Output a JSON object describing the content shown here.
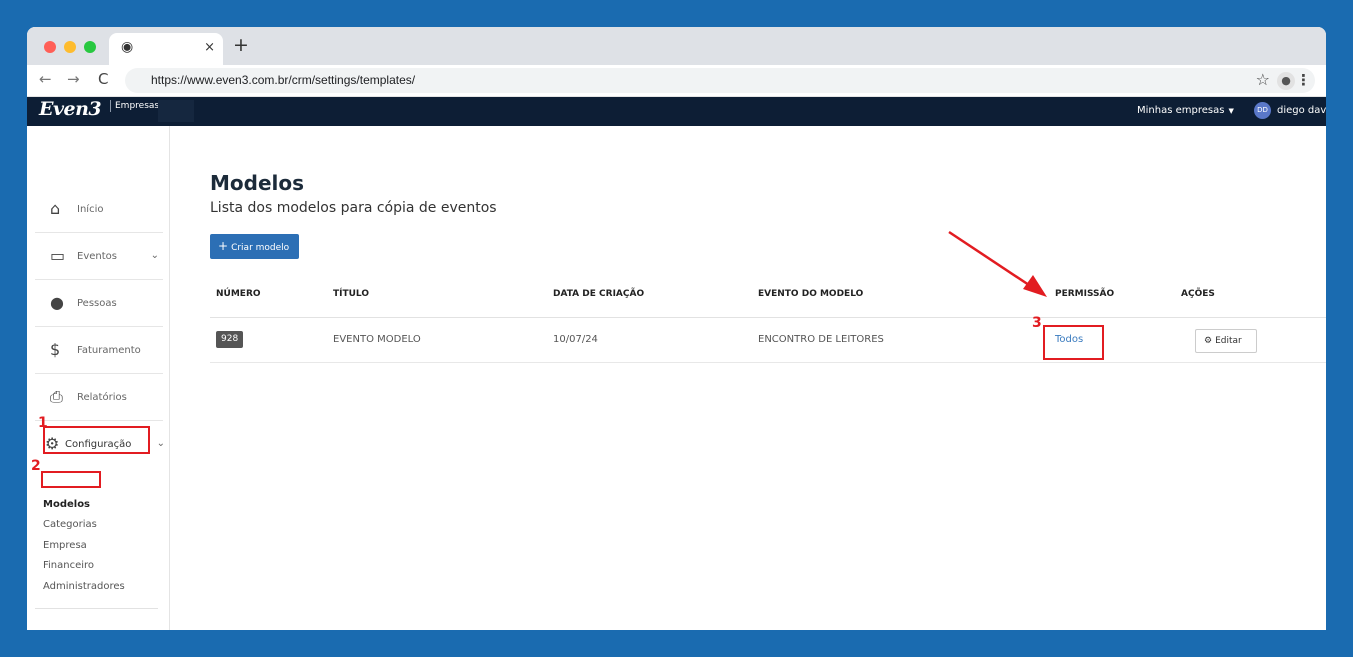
{
  "browser": {
    "tab_favicon": "chrome-icon",
    "tab_close": "×",
    "new_tab": "+",
    "back": "←",
    "forward": "→",
    "reload": "C",
    "url": "https://www.even3.com.br/crm/settings/templates/",
    "star": "☆",
    "profile": "●",
    "menu": "⋮"
  },
  "header": {
    "logo": "Even3",
    "logo_sub": "Empresas",
    "companies_label": "Minhas empresas",
    "companies_caret": "▼",
    "user_initials": "DD",
    "user_name": "diego davi"
  },
  "sidebar": {
    "items": [
      {
        "label": "Início",
        "icon": "home-icon",
        "glyph": "⌂"
      },
      {
        "label": "Eventos",
        "icon": "calendar-icon",
        "glyph": "▭",
        "chevron": "⌄"
      },
      {
        "label": "Pessoas",
        "icon": "person-icon",
        "glyph": "●"
      },
      {
        "label": "Faturamento",
        "icon": "money-bag-icon",
        "glyph": "$"
      },
      {
        "label": "Relatórios",
        "icon": "printer-icon",
        "glyph": "⎙"
      },
      {
        "label": "Configuração",
        "icon": "gears-icon",
        "glyph": "⚙",
        "chevron": "⌄"
      }
    ],
    "submenu": [
      "Modelos",
      "Categorias",
      "Empresa",
      "Financeiro",
      "Administradores"
    ]
  },
  "main": {
    "title": "Modelos",
    "subtitle": "Lista dos modelos para cópia de eventos",
    "create_button": "Criar modelo",
    "create_plus": "+",
    "table": {
      "headers": [
        "NÚMERO",
        "TÍTULO",
        "DATA DE CRIAÇÃO",
        "EVENTO DO MODELO",
        "PERMISSÃO",
        "AÇÕES"
      ],
      "rows": [
        {
          "numero": "928",
          "titulo": "EVENTO MODELO",
          "data": "10/07/24",
          "evento": "ENCONTRO DE LEITORES",
          "permissao": "Todos",
          "acao": "Editar",
          "acao_icon": "⚙"
        }
      ]
    }
  },
  "annotations": {
    "labels": [
      "1",
      "2",
      "3"
    ],
    "color": "#e21c21"
  },
  "colors": {
    "background": "#1a6bb0",
    "header": "#0d1e35",
    "primary_button": "#2c6fb5",
    "link": "#3a7bbf"
  }
}
